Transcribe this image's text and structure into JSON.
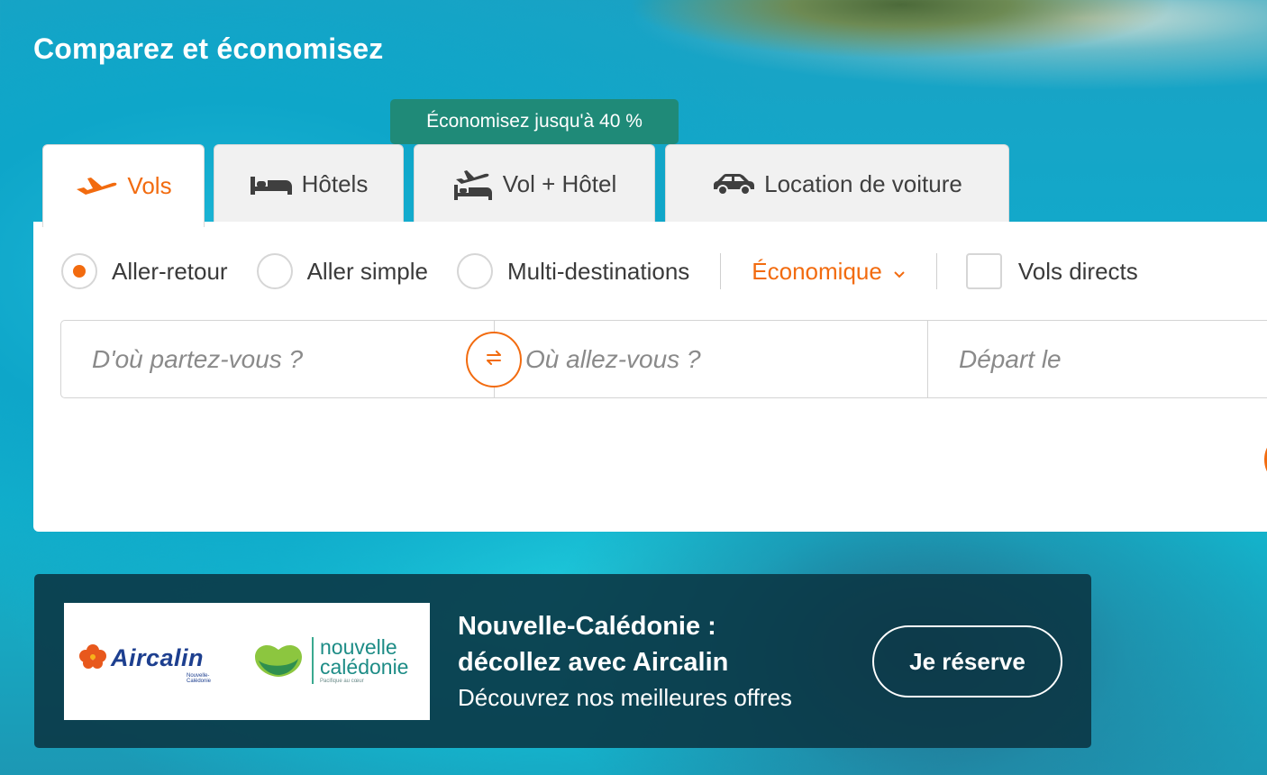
{
  "headline": "Comparez et économisez",
  "tooltip": "Économisez jusqu'à 40 %",
  "tabs": [
    {
      "label": "Vols",
      "icon": "plane-icon",
      "active": true
    },
    {
      "label": "Hôtels",
      "icon": "bed-icon",
      "active": false
    },
    {
      "label": "Vol + Hôtel",
      "icon": "plane-bed-icon",
      "active": false
    },
    {
      "label": "Location de voiture",
      "icon": "car-icon",
      "active": false
    }
  ],
  "trip_types": [
    {
      "label": "Aller-retour",
      "selected": true
    },
    {
      "label": "Aller simple",
      "selected": false
    },
    {
      "label": "Multi-destinations",
      "selected": false
    }
  ],
  "cabin_class": "Économique",
  "direct_flights_label": "Vols directs",
  "fields": {
    "origin_placeholder": "D'où partez-vous ?",
    "destination_placeholder": "Où allez-vous ?",
    "departure_placeholder": "Départ le"
  },
  "banner": {
    "title_line1": "Nouvelle-Calédonie :",
    "title_line2": "décollez avec Aircalin",
    "subtitle": "Découvrez nos meilleures offres",
    "button": "Je réserve",
    "logo_aircalin": "Aircalin",
    "logo_aircalin_sub": "Nouvelle-Calédonie",
    "logo_nc_line1": "nouvelle",
    "logo_nc_line2": "calédonie",
    "logo_nc_small": "Pacifique au cœur"
  },
  "colors": {
    "accent": "#f26b0f",
    "tooltip_bg": "#1f8a78",
    "banner_bg": "#0a3442"
  }
}
